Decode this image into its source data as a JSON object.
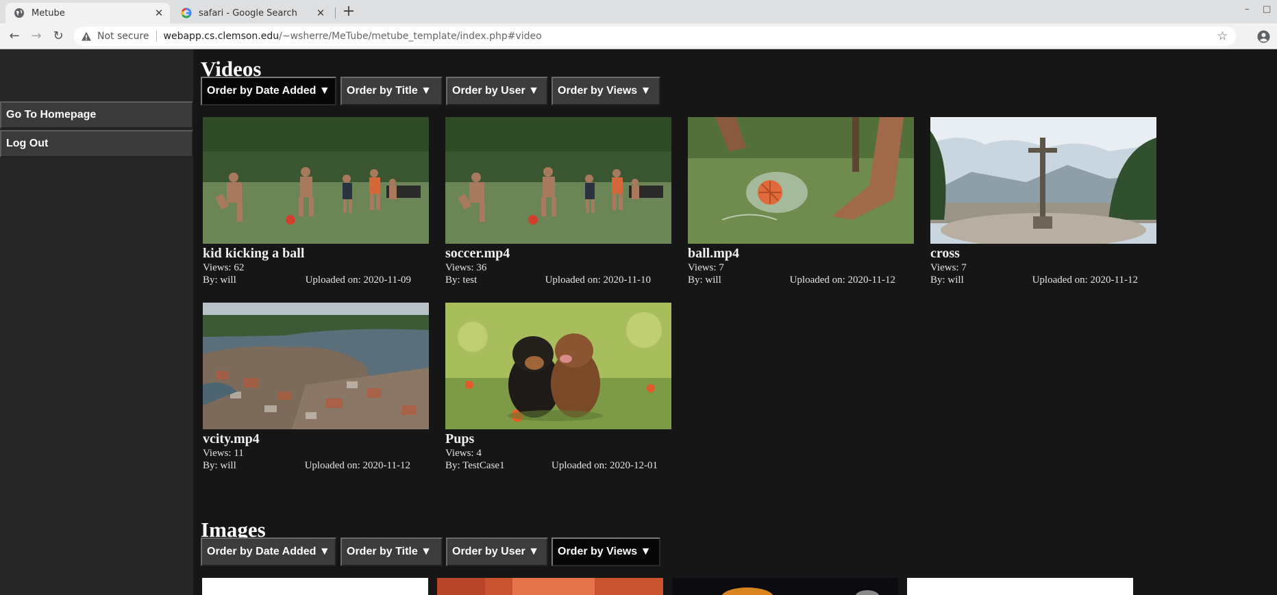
{
  "browser": {
    "tabs": [
      {
        "title": "Metube",
        "active": true
      },
      {
        "title": "safari - Google Search",
        "active": false
      }
    ],
    "address": {
      "security_label": "Not secure",
      "host": "webapp.cs.clemson.edu",
      "path": "/~wsherre/MeTube/metube_template/index.php#video"
    }
  },
  "sidebar": {
    "items": [
      {
        "label": "Go To Homepage"
      },
      {
        "label": "Log Out"
      }
    ]
  },
  "videos": {
    "title": "Videos",
    "sort_buttons": [
      {
        "label": "Order by Date Added ▼",
        "selected": true
      },
      {
        "label": "Order by Title ▼",
        "selected": false
      },
      {
        "label": "Order by User ▼",
        "selected": false
      },
      {
        "label": "Order by Views ▼",
        "selected": false
      }
    ],
    "items": [
      {
        "title": "kid kicking a ball",
        "views": "Views: 62",
        "by": "By: will",
        "uploaded": "Uploaded on: 2020-11-09",
        "thumbnail": "kids-soccer-field"
      },
      {
        "title": "soccer.mp4",
        "views": "Views: 36",
        "by": "By: test",
        "uploaded": "Uploaded on: 2020-11-10",
        "thumbnail": "kids-soccer-field"
      },
      {
        "title": "ball.mp4",
        "views": "Views: 7",
        "by": "By: will",
        "uploaded": "Uploaded on: 2020-11-12",
        "thumbnail": "foot-kicking-ball-splash"
      },
      {
        "title": "cross",
        "views": "Views: 7",
        "by": "By: will",
        "uploaded": "Uploaded on: 2020-11-12",
        "thumbnail": "hilltop-cross"
      },
      {
        "title": "vcity.mp4",
        "views": "Views: 11",
        "by": "By: will",
        "uploaded": "Uploaded on: 2020-11-12",
        "thumbnail": "lake-town-aerial"
      },
      {
        "title": "Pups",
        "views": "Views: 4",
        "by": "By: TestCase1",
        "uploaded": "Uploaded on: 2020-12-01",
        "thumbnail": "two-puppies-grass"
      }
    ]
  },
  "images": {
    "title": "Images",
    "sort_buttons": [
      {
        "label": "Order by Date Added ▼",
        "selected": false
      },
      {
        "label": "Order by Title ▼",
        "selected": false
      },
      {
        "label": "Order by User ▼",
        "selected": false
      },
      {
        "label": "Order by Views ▼",
        "selected": true
      }
    ]
  }
}
